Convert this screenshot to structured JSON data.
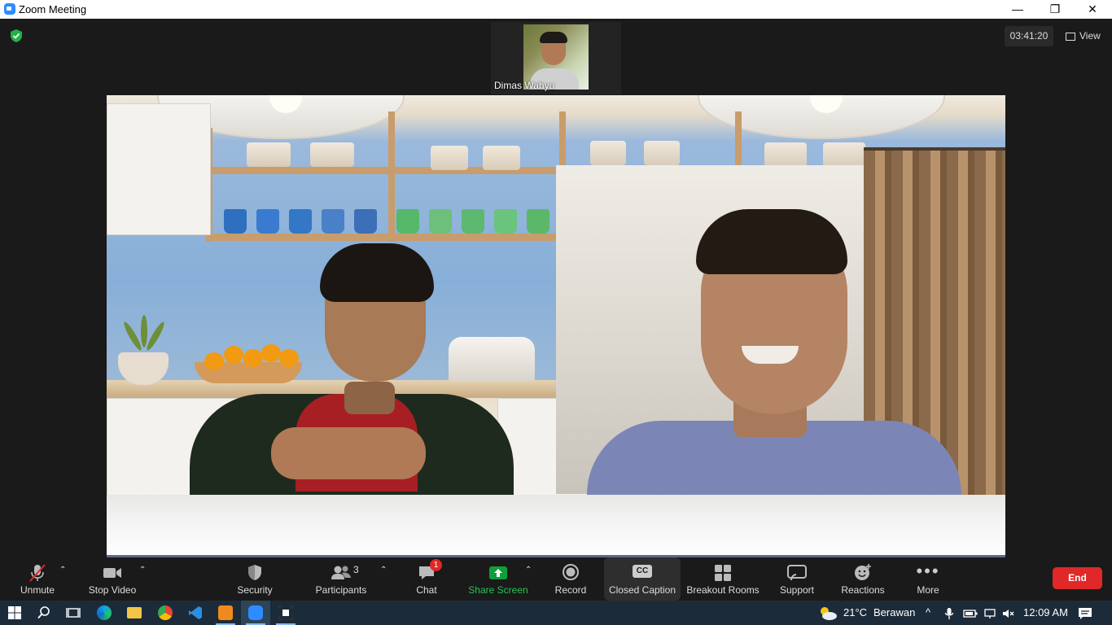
{
  "window": {
    "title": "Zoom Meeting",
    "minimize": "—",
    "restore": "❐",
    "close": "✕"
  },
  "meeting": {
    "thumbnail_name": "Dimas Wahyu",
    "timer": "03:41:20",
    "view_label": "View"
  },
  "toolbar": {
    "unmute": "Unmute",
    "stop_video": "Stop Video",
    "security": "Security",
    "participants": "Participants",
    "participants_count": "3",
    "chat": "Chat",
    "chat_badge": "1",
    "share_screen": "Share Screen",
    "record": "Record",
    "closed_caption": "Closed Caption",
    "cc_glyph": "CC",
    "breakout_rooms": "Breakout Rooms",
    "support": "Support",
    "reactions": "Reactions",
    "more": "More",
    "end": "End"
  },
  "taskbar": {
    "weather_temp": "21°C",
    "weather_text": "Berawan",
    "clock": "12:09 AM"
  },
  "colors": {
    "zoom_blue": "#2d8cff",
    "share_green": "#0e9f3a",
    "end_red": "#e02828",
    "toolbar_bg": "#1a1a1a"
  }
}
